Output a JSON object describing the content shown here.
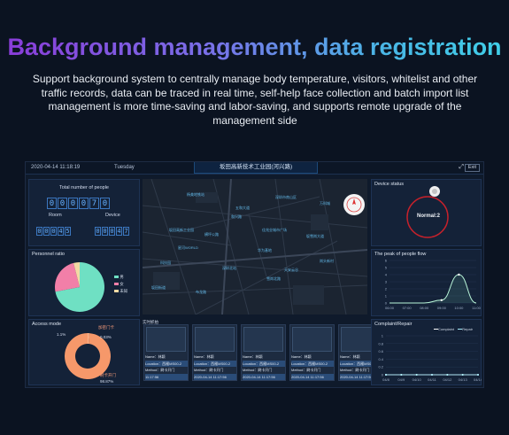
{
  "hero": {
    "title": "Background management, data registration",
    "subtitle": "Support background system to centrally manage body temperature, visitors, whitelist and other traffic records, data can be traced in real time, self-help face collection and batch import list management is more time-saving and labor-saving, and supports remote upgrade of the management side"
  },
  "topbar": {
    "datetime": "2020-04-14 11:18:19",
    "weekday": "Tuesday",
    "center_title": "坂田高新技术工业园(河兴路)",
    "exit_label": "Exit",
    "expand_glyph": "⤢"
  },
  "people": {
    "title": "Total number of people",
    "total_digits": [
      "0",
      "0",
      "0",
      "0",
      "7",
      "0"
    ],
    "room_label": "Room",
    "room_digits": [
      "0",
      "0",
      "0",
      "4",
      "5"
    ],
    "device_label": "Device",
    "device_digits": [
      "0",
      "0",
      "0",
      "4",
      "7"
    ]
  },
  "personnel": {
    "title": "Personnel ratio",
    "legend": [
      "男",
      "女",
      "未知"
    ],
    "colors": [
      "#6fe0c3",
      "#f27fa8",
      "#f3d9a4"
    ]
  },
  "access": {
    "title": "Access mode",
    "label_a": "加密门卡",
    "pct_a": "1.1%",
    "pct_b": "0.03%",
    "label_c": "刷卡开门",
    "pct_c": "98.87%"
  },
  "map": {
    "labels": [
      "深圳市南山区",
      "和兴路",
      "坂田高新工业园",
      "横坪公路",
      "五和大道",
      "华为基地",
      "科技园",
      "坂雪岗大道",
      "雪岗北路",
      "布龙路",
      "岗头新村",
      "坂田街道",
      "天安云谷",
      "深圳北站",
      "杨美地铁站",
      "佳兆业城市广场",
      "星河WORLD",
      "万科城"
    ]
  },
  "device_status": {
    "title": "Device status",
    "label": "Normal:2"
  },
  "flow": {
    "title": "The peak of people flow"
  },
  "snapshot": {
    "title": "实时抓拍",
    "cards": [
      {
        "name": "Name：林颖",
        "location": "Location：西雁MS00-2",
        "method": "Method：刷卡开门",
        "time": "11:17:56"
      },
      {
        "name": "Name：林颖",
        "location": "Location：西雁MS00-2",
        "method": "Method：刷卡开门",
        "time": "2020-04-14 11:17:56"
      },
      {
        "name": "Name：林颖",
        "location": "Location：西雁MS00-2",
        "method": "Method：刷卡开门",
        "time": "2020-04-14 11:17:56"
      },
      {
        "name": "Name：林颖",
        "location": "Location：西雁MS00-2",
        "method": "Method：刷卡开门",
        "time": "2020-04-14 11:17:56"
      },
      {
        "name": "Name：林颖",
        "location": "Location：西雁MS00-2",
        "method": "Method：刷卡开门",
        "time": "2020-04-14 11:17:56"
      }
    ]
  },
  "complaint": {
    "title": "Complaint/Repair",
    "legend_a": "Complaint",
    "legend_b": "Repair"
  },
  "chart_data": [
    {
      "type": "pie",
      "categories": [
        "男",
        "女",
        "未知"
      ],
      "values": [
        72,
        24,
        4
      ]
    },
    {
      "type": "pie",
      "categories": [
        "加密门卡",
        "0.03%",
        "刷卡开门"
      ],
      "values": [
        1.1,
        0.03,
        98.87
      ]
    },
    {
      "type": "area",
      "x": [
        "06:00",
        "07:00",
        "08:00",
        "09:00",
        "10:00",
        "11:00"
      ],
      "values": [
        0,
        0,
        0,
        0.4,
        4,
        0
      ],
      "ylim": [
        0,
        6
      ],
      "yticks": [
        0,
        1,
        2,
        3,
        4,
        5,
        6
      ]
    },
    {
      "type": "line",
      "x": [
        "04/8",
        "04/9",
        "04/10",
        "04/11",
        "04/12",
        "04/13",
        "04/14"
      ],
      "series": [
        {
          "name": "Complaint",
          "values": [
            0,
            0,
            0,
            0,
            0,
            0,
            0
          ]
        },
        {
          "name": "Repair",
          "values": [
            0,
            0,
            0,
            0,
            0,
            0,
            0
          ]
        }
      ],
      "ylim": [
        0,
        1
      ],
      "yticks": [
        0,
        0.2,
        0.4,
        0.6,
        0.8,
        1
      ]
    }
  ]
}
